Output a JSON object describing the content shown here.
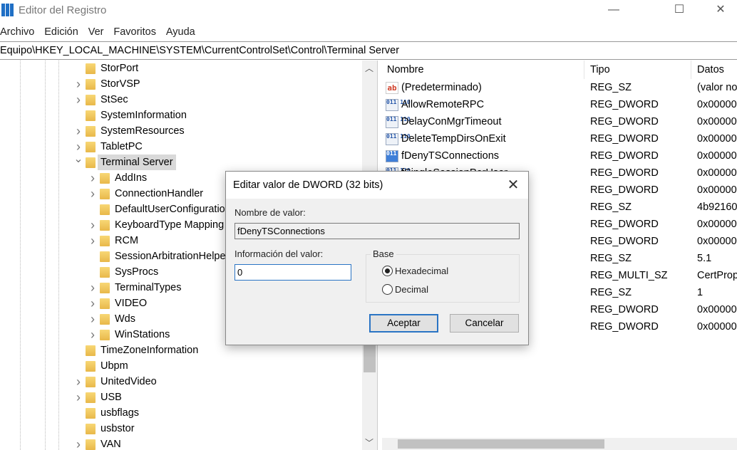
{
  "window": {
    "title": "Editor del Registro",
    "controls": {
      "minimize": "—",
      "maximize": "☐",
      "close": "✕"
    }
  },
  "menu": [
    "Archivo",
    "Edición",
    "Ver",
    "Favoritos",
    "Ayuda"
  ],
  "address": "Equipo\\HKEY_LOCAL_MACHINE\\SYSTEM\\CurrentControlSet\\Control\\Terminal Server",
  "tree": [
    {
      "label": "StorPort",
      "level": 0,
      "expander": ""
    },
    {
      "label": "StorVSP",
      "level": 0,
      "expander": ">"
    },
    {
      "label": "StSec",
      "level": 0,
      "expander": ">"
    },
    {
      "label": "SystemInformation",
      "level": 0,
      "expander": ""
    },
    {
      "label": "SystemResources",
      "level": 0,
      "expander": ">"
    },
    {
      "label": "TabletPC",
      "level": 0,
      "expander": ">"
    },
    {
      "label": "Terminal Server",
      "level": 0,
      "expander": "v",
      "selected": true
    },
    {
      "label": "AddIns",
      "level": 1,
      "expander": ">"
    },
    {
      "label": "ConnectionHandler",
      "level": 1,
      "expander": ">"
    },
    {
      "label": "DefaultUserConfiguration",
      "level": 1,
      "expander": ""
    },
    {
      "label": "KeyboardType Mapping",
      "level": 1,
      "expander": ">"
    },
    {
      "label": "RCM",
      "level": 1,
      "expander": ">"
    },
    {
      "label": "SessionArbitrationHelper",
      "level": 1,
      "expander": ""
    },
    {
      "label": "SysProcs",
      "level": 1,
      "expander": ""
    },
    {
      "label": "TerminalTypes",
      "level": 1,
      "expander": ">"
    },
    {
      "label": "VIDEO",
      "level": 1,
      "expander": ">"
    },
    {
      "label": "Wds",
      "level": 1,
      "expander": ">"
    },
    {
      "label": "WinStations",
      "level": 1,
      "expander": ">"
    },
    {
      "label": "TimeZoneInformation",
      "level": 0,
      "expander": ""
    },
    {
      "label": "Ubpm",
      "level": 0,
      "expander": ""
    },
    {
      "label": "UnitedVideo",
      "level": 0,
      "expander": ">"
    },
    {
      "label": "USB",
      "level": 0,
      "expander": ">"
    },
    {
      "label": "usbflags",
      "level": 0,
      "expander": ""
    },
    {
      "label": "usbstor",
      "level": 0,
      "expander": ""
    },
    {
      "label": "VAN",
      "level": 0,
      "expander": ">"
    }
  ],
  "list": {
    "columns": [
      "Nombre",
      "Tipo",
      "Datos"
    ],
    "rows": [
      {
        "name": "(Predeterminado)",
        "type": "REG_SZ",
        "data": "(valor no",
        "icon": "string-value-icon"
      },
      {
        "name": "AllowRemoteRPC",
        "type": "REG_DWORD",
        "data": "0x000000",
        "icon": "binary-value-icon"
      },
      {
        "name": "DelayConMgrTimeout",
        "type": "REG_DWORD",
        "data": "0x000000",
        "icon": "binary-value-icon"
      },
      {
        "name": "DeleteTempDirsOnExit",
        "type": "REG_DWORD",
        "data": "0x000000",
        "icon": "binary-value-icon"
      },
      {
        "name": "fDenyTSConnections",
        "type": "REG_DWORD",
        "data": "0x000000",
        "icon": "binary-value-icon",
        "selected": true
      },
      {
        "name": "fSingleSessionPerUser",
        "type": "REG_DWORD",
        "data": "0x000000",
        "icon": "binary-value-icon"
      },
      {
        "name": "",
        "type": "REG_DWORD",
        "data": "0x000000"
      },
      {
        "name": "",
        "type": "REG_SZ",
        "data": "4b92160"
      },
      {
        "name": "",
        "type": "REG_DWORD",
        "data": "0x000000"
      },
      {
        "name": "",
        "type": "REG_DWORD",
        "data": "0x000000"
      },
      {
        "name": "",
        "type": "REG_SZ",
        "data": "5.1"
      },
      {
        "name": "",
        "type": "REG_MULTI_SZ",
        "data": "CertProp"
      },
      {
        "name": "",
        "type": "REG_SZ",
        "data": "1"
      },
      {
        "name": "",
        "type": "REG_DWORD",
        "data": "0x000000"
      },
      {
        "name": "",
        "type": "REG_DWORD",
        "data": "0x000000"
      }
    ]
  },
  "dialog": {
    "title": "Editar valor de DWORD (32 bits)",
    "name_label": "Nombre de valor:",
    "name_value": "fDenyTSConnections",
    "data_label": "Información del valor:",
    "data_value": "0",
    "base_label": "Base",
    "hex_label": "Hexadecimal",
    "dec_label": "Decimal",
    "base_selected": "Hexadecimal",
    "ok": "Aceptar",
    "cancel": "Cancelar",
    "close": "✕"
  }
}
